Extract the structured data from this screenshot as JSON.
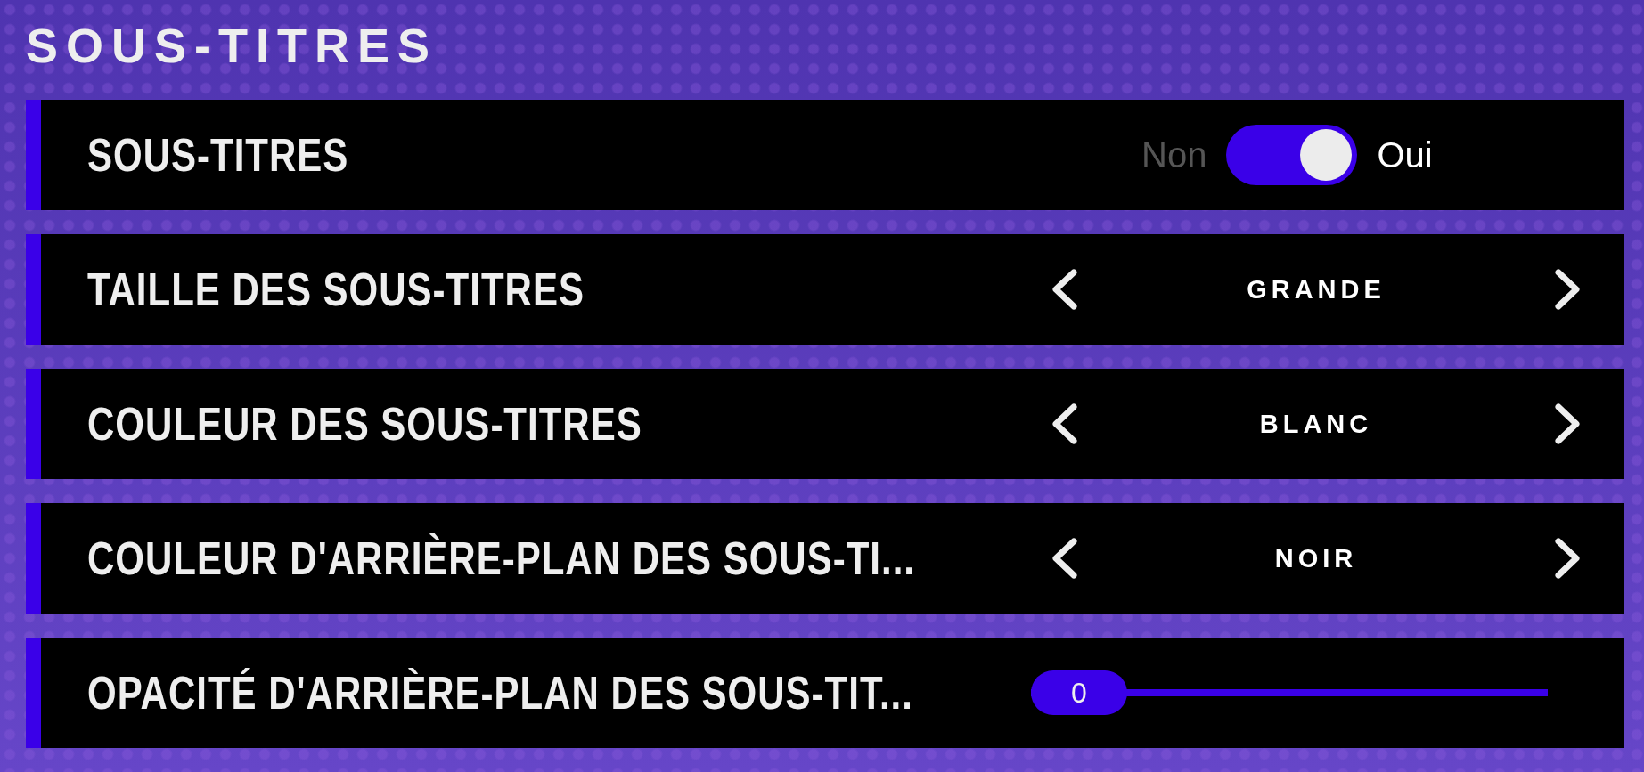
{
  "title": "SOUS-TITRES",
  "rows": [
    {
      "kind": "toggle",
      "label": "SOUS-TITRES",
      "off_label": "Non",
      "on_label": "Oui",
      "on": true
    },
    {
      "kind": "selector",
      "label": "TAILLE DES SOUS-TITRES",
      "value": "GRANDE"
    },
    {
      "kind": "selector",
      "label": "COULEUR DES SOUS-TITRES",
      "value": "BLANC"
    },
    {
      "kind": "selector",
      "label": "COULEUR D'ARRIÈRE-PLAN DES SOUS-TI...",
      "value": "NOIR"
    },
    {
      "kind": "slider",
      "label": "OPACITÉ D'ARRIÈRE-PLAN DES SOUS-TIT...",
      "value": "0",
      "level": 0
    }
  ]
}
